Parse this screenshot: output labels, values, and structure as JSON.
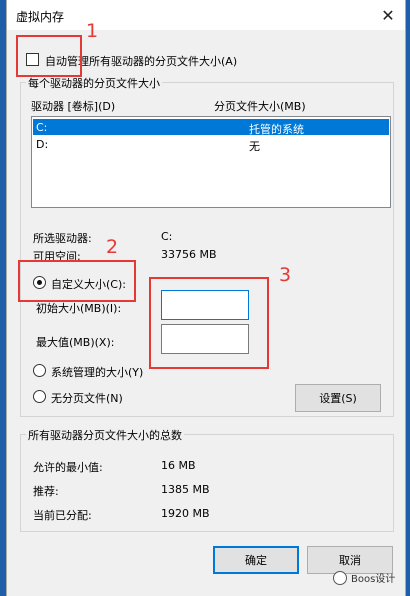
{
  "window": {
    "title": "虚拟内存",
    "close_glyph": "✕"
  },
  "auto_manage": {
    "label": "自动管理所有驱动器的分页文件大小(A)",
    "checked": false
  },
  "per_drive": {
    "group_label": "每个驱动器的分页文件大小",
    "col_drive": "驱动器 [卷标](D)",
    "col_size": "分页文件大小(MB)",
    "rows": [
      {
        "drive": "C:",
        "size": "托管的系统",
        "selected": true
      },
      {
        "drive": "D:",
        "size": "无",
        "selected": false
      }
    ],
    "selected_drive_label": "所选驱动器:",
    "selected_drive_value": "C:",
    "free_space_label": "可用空间:",
    "free_space_value": "33756 MB",
    "custom_size_label": "自定义大小(C):",
    "initial_size_label": "初始大小(MB)(I):",
    "initial_size_value": "",
    "max_size_label": "最大值(MB)(X):",
    "max_size_value": "",
    "system_managed_label": "系统管理的大小(Y)",
    "no_paging_label": "无分页文件(N)",
    "set_button": "设置(S)",
    "selected_option": "custom"
  },
  "totals": {
    "group_label": "所有驱动器分页文件大小的总数",
    "min_label": "允许的最小值:",
    "min_value": "16 MB",
    "recommended_label": "推荐:",
    "recommended_value": "1385 MB",
    "current_label": "当前已分配:",
    "current_value": "1920 MB"
  },
  "buttons": {
    "ok": "确定",
    "cancel": "取消"
  },
  "annotations": {
    "n1": "1",
    "n2": "2",
    "n3": "3",
    "color": "#e53935"
  },
  "watermark": {
    "text": "Boos设计"
  }
}
